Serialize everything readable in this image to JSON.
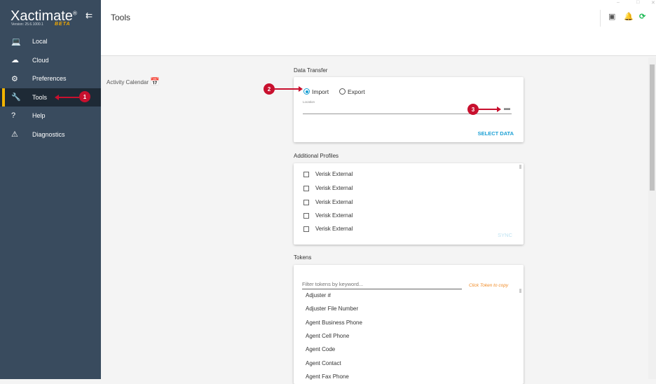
{
  "app": {
    "name": "Xactimate",
    "version": "Version: 25.6.1000.1",
    "beta": "BETA"
  },
  "sidebar": {
    "items": [
      {
        "label": "Local",
        "icon": "laptop-icon",
        "glyph": "💻"
      },
      {
        "label": "Cloud",
        "icon": "cloud-icon",
        "glyph": "☁"
      },
      {
        "label": "Preferences",
        "icon": "gear-icon",
        "glyph": "⚙"
      },
      {
        "label": "Tools",
        "icon": "wrench-icon",
        "glyph": "🔧",
        "active": true
      },
      {
        "label": "Help",
        "icon": "help-icon",
        "glyph": "?"
      },
      {
        "label": "Diagnostics",
        "icon": "warning-icon",
        "glyph": "⚠"
      }
    ]
  },
  "header": {
    "title": "Tools"
  },
  "annotations": [
    "1",
    "2",
    "3"
  ],
  "activity": {
    "label": "Activity Calendar"
  },
  "data_transfer": {
    "title": "Data Transfer",
    "import": "Import",
    "export": "Export",
    "selected": "Import",
    "location_label": "Location",
    "location_value": "",
    "select_button": "SELECT DATA"
  },
  "profiles": {
    "title": "Additional Profiles",
    "items": [
      "Verisk External",
      "Verisk External",
      "Verisk External",
      "Verisk External",
      "Verisk External"
    ],
    "sync": "SYNC"
  },
  "tokens": {
    "title": "Tokens",
    "filter_placeholder": "Filter tokens by keyword...",
    "hint": "Click Token to copy",
    "items": [
      "Adjuster #",
      "Adjuster File Number",
      "Agent Business Phone",
      "Agent Cell Phone",
      "Agent Code",
      "Agent Contact",
      "Agent Fax Phone"
    ]
  },
  "colors": {
    "sidebar": "#394b5e",
    "accent": "#1a9fd4",
    "active_bar": "#f2b400",
    "annotation": "#c8102e",
    "sync_icon": "#1db954"
  }
}
